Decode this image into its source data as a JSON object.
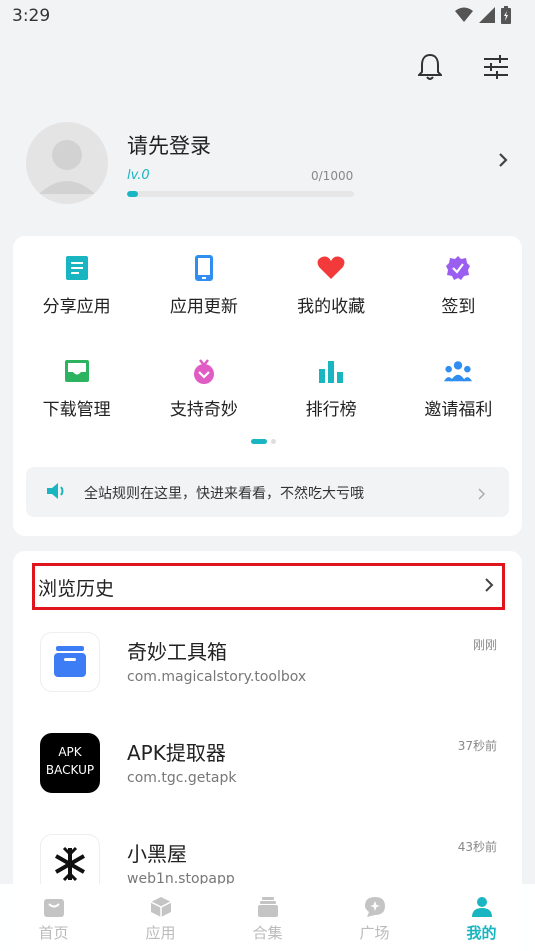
{
  "status_bar": {
    "time": "3:29"
  },
  "profile": {
    "username": "请先登录",
    "level": "lv.0",
    "exp": "0/1000",
    "progress": 0.05
  },
  "quick_actions": [
    {
      "label": "分享应用",
      "icon": "share-app-icon",
      "color": "#19b5c1"
    },
    {
      "label": "应用更新",
      "icon": "app-update-icon",
      "color": "#2f8ef0"
    },
    {
      "label": "我的收藏",
      "icon": "heart-icon",
      "color": "#f23a3a"
    },
    {
      "label": "签到",
      "icon": "check-in-icon",
      "color": "#9a5ff0"
    },
    {
      "label": "下载管理",
      "icon": "download-manage-icon",
      "color": "#2bb35f"
    },
    {
      "label": "支持奇妙",
      "icon": "support-icon",
      "color": "#e05cc4"
    },
    {
      "label": "排行榜",
      "icon": "ranking-icon",
      "color": "#19b5c1"
    },
    {
      "label": "邀请福利",
      "icon": "invite-icon",
      "color": "#2f8ef0"
    }
  ],
  "notice": {
    "text": "全站规则在这里，快进来看看，不然吃大亏哦"
  },
  "history": {
    "title": "浏览历史",
    "items": [
      {
        "name": "奇妙工具箱",
        "package": "com.magicalstory.toolbox",
        "time": "刚刚"
      },
      {
        "name": "APK提取器",
        "package": "com.tgc.getapk",
        "time": "37秒前",
        "icon_text": [
          "APK",
          "BACKUP"
        ]
      },
      {
        "name": "小黑屋",
        "package": "web1n.stopapp",
        "time": "43秒前"
      }
    ]
  },
  "tabbar": [
    {
      "label": "首页",
      "icon": "home-icon"
    },
    {
      "label": "应用",
      "icon": "apps-icon"
    },
    {
      "label": "合集",
      "icon": "collection-icon"
    },
    {
      "label": "广场",
      "icon": "plaza-icon"
    },
    {
      "label": "我的",
      "icon": "profile-icon",
      "active": true
    }
  ],
  "colors": {
    "accent": "#19b5c1",
    "highlight_border": "#e0141c"
  }
}
